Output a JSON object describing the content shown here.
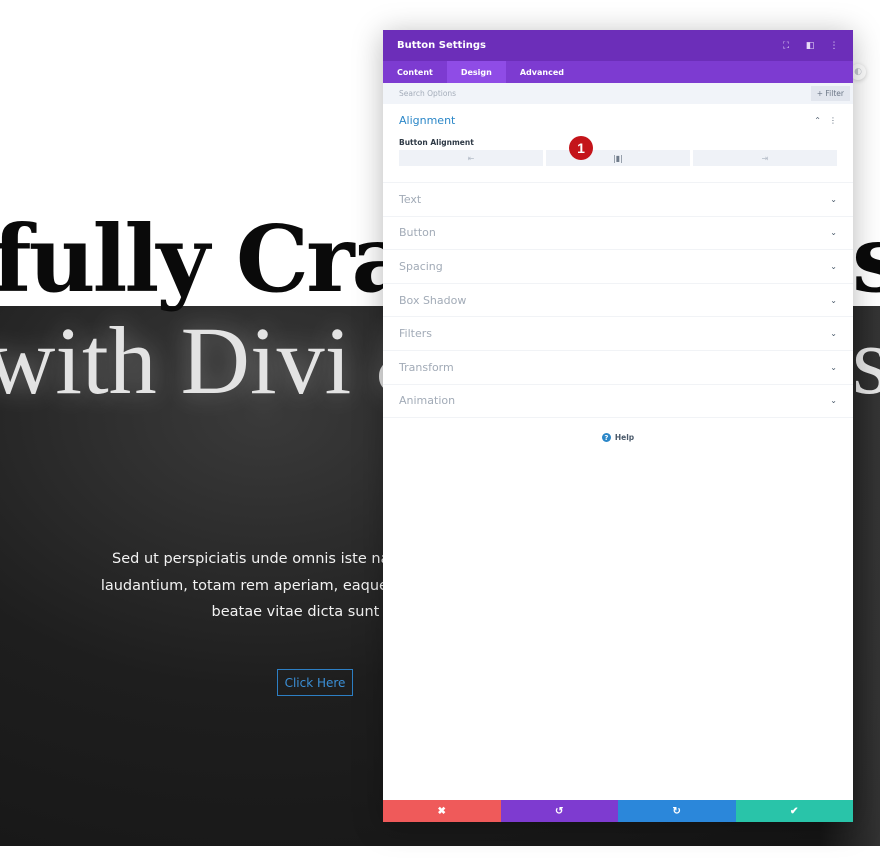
{
  "page": {
    "hero_title": "fully Craf",
    "hero_title_right": "s",
    "hero_subtitle": "with Divi &",
    "hero_subtitle_right": "s",
    "body_lines": [
      "Sed ut perspiciatis unde omnis iste natus error sit volup",
      "laudantium, totam rem aperiam, eaque ipsa quae ab illo in",
      "beatae vitae dicta sunt expli"
    ],
    "button_label": "Click Here"
  },
  "modal": {
    "title": "Button Settings",
    "header_icons": [
      "fullscreen-icon",
      "split-view-icon",
      "more-options-icon"
    ],
    "tabs": [
      {
        "label": "Content",
        "active": false
      },
      {
        "label": "Design",
        "active": true
      },
      {
        "label": "Advanced",
        "active": false
      }
    ],
    "search": {
      "placeholder": "Search Options"
    },
    "filter_label": "+ Filter",
    "open_section": {
      "title": "Alignment",
      "field_label": "Button Alignment",
      "options": [
        {
          "name": "left",
          "glyph": "⇤"
        },
        {
          "name": "center",
          "glyph": "|▮|",
          "active": true
        },
        {
          "name": "right",
          "glyph": "⇥"
        }
      ],
      "step_badge": "1"
    },
    "sections": [
      "Text",
      "Button",
      "Spacing",
      "Box Shadow",
      "Filters",
      "Transform",
      "Animation"
    ],
    "help_label": "Help",
    "footer": {
      "cancel": {
        "glyph": "✖",
        "color": "#ef5a5a"
      },
      "undo": {
        "glyph": "↺",
        "color": "#7e3bd0"
      },
      "redo": {
        "glyph": "↻",
        "color": "#2b87da"
      },
      "save": {
        "glyph": "✔",
        "color": "#29c4a9"
      }
    }
  },
  "colors": {
    "header_purple": "#6c2eb9",
    "tab_purple": "#7d3bd1",
    "active_tab": "#8f4ce6",
    "accent_blue": "#2b87c8",
    "badge_red": "#c4141a"
  }
}
